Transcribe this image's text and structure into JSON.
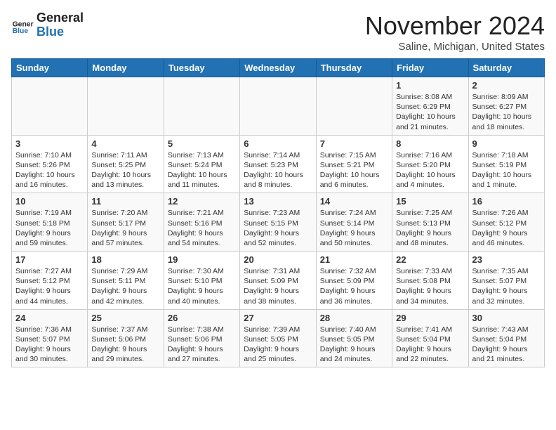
{
  "header": {
    "logo_general": "General",
    "logo_blue": "Blue",
    "month": "November 2024",
    "location": "Saline, Michigan, United States"
  },
  "days_of_week": [
    "Sunday",
    "Monday",
    "Tuesday",
    "Wednesday",
    "Thursday",
    "Friday",
    "Saturday"
  ],
  "weeks": [
    [
      {
        "day": "",
        "info": ""
      },
      {
        "day": "",
        "info": ""
      },
      {
        "day": "",
        "info": ""
      },
      {
        "day": "",
        "info": ""
      },
      {
        "day": "",
        "info": ""
      },
      {
        "day": "1",
        "info": "Sunrise: 8:08 AM\nSunset: 6:29 PM\nDaylight: 10 hours\nand 21 minutes."
      },
      {
        "day": "2",
        "info": "Sunrise: 8:09 AM\nSunset: 6:27 PM\nDaylight: 10 hours\nand 18 minutes."
      }
    ],
    [
      {
        "day": "3",
        "info": "Sunrise: 7:10 AM\nSunset: 5:26 PM\nDaylight: 10 hours\nand 16 minutes."
      },
      {
        "day": "4",
        "info": "Sunrise: 7:11 AM\nSunset: 5:25 PM\nDaylight: 10 hours\nand 13 minutes."
      },
      {
        "day": "5",
        "info": "Sunrise: 7:13 AM\nSunset: 5:24 PM\nDaylight: 10 hours\nand 11 minutes."
      },
      {
        "day": "6",
        "info": "Sunrise: 7:14 AM\nSunset: 5:23 PM\nDaylight: 10 hours\nand 8 minutes."
      },
      {
        "day": "7",
        "info": "Sunrise: 7:15 AM\nSunset: 5:21 PM\nDaylight: 10 hours\nand 6 minutes."
      },
      {
        "day": "8",
        "info": "Sunrise: 7:16 AM\nSunset: 5:20 PM\nDaylight: 10 hours\nand 4 minutes."
      },
      {
        "day": "9",
        "info": "Sunrise: 7:18 AM\nSunset: 5:19 PM\nDaylight: 10 hours\nand 1 minute."
      }
    ],
    [
      {
        "day": "10",
        "info": "Sunrise: 7:19 AM\nSunset: 5:18 PM\nDaylight: 9 hours\nand 59 minutes."
      },
      {
        "day": "11",
        "info": "Sunrise: 7:20 AM\nSunset: 5:17 PM\nDaylight: 9 hours\nand 57 minutes."
      },
      {
        "day": "12",
        "info": "Sunrise: 7:21 AM\nSunset: 5:16 PM\nDaylight: 9 hours\nand 54 minutes."
      },
      {
        "day": "13",
        "info": "Sunrise: 7:23 AM\nSunset: 5:15 PM\nDaylight: 9 hours\nand 52 minutes."
      },
      {
        "day": "14",
        "info": "Sunrise: 7:24 AM\nSunset: 5:14 PM\nDaylight: 9 hours\nand 50 minutes."
      },
      {
        "day": "15",
        "info": "Sunrise: 7:25 AM\nSunset: 5:13 PM\nDaylight: 9 hours\nand 48 minutes."
      },
      {
        "day": "16",
        "info": "Sunrise: 7:26 AM\nSunset: 5:12 PM\nDaylight: 9 hours\nand 46 minutes."
      }
    ],
    [
      {
        "day": "17",
        "info": "Sunrise: 7:27 AM\nSunset: 5:12 PM\nDaylight: 9 hours\nand 44 minutes."
      },
      {
        "day": "18",
        "info": "Sunrise: 7:29 AM\nSunset: 5:11 PM\nDaylight: 9 hours\nand 42 minutes."
      },
      {
        "day": "19",
        "info": "Sunrise: 7:30 AM\nSunset: 5:10 PM\nDaylight: 9 hours\nand 40 minutes."
      },
      {
        "day": "20",
        "info": "Sunrise: 7:31 AM\nSunset: 5:09 PM\nDaylight: 9 hours\nand 38 minutes."
      },
      {
        "day": "21",
        "info": "Sunrise: 7:32 AM\nSunset: 5:09 PM\nDaylight: 9 hours\nand 36 minutes."
      },
      {
        "day": "22",
        "info": "Sunrise: 7:33 AM\nSunset: 5:08 PM\nDaylight: 9 hours\nand 34 minutes."
      },
      {
        "day": "23",
        "info": "Sunrise: 7:35 AM\nSunset: 5:07 PM\nDaylight: 9 hours\nand 32 minutes."
      }
    ],
    [
      {
        "day": "24",
        "info": "Sunrise: 7:36 AM\nSunset: 5:07 PM\nDaylight: 9 hours\nand 30 minutes."
      },
      {
        "day": "25",
        "info": "Sunrise: 7:37 AM\nSunset: 5:06 PM\nDaylight: 9 hours\nand 29 minutes."
      },
      {
        "day": "26",
        "info": "Sunrise: 7:38 AM\nSunset: 5:06 PM\nDaylight: 9 hours\nand 27 minutes."
      },
      {
        "day": "27",
        "info": "Sunrise: 7:39 AM\nSunset: 5:05 PM\nDaylight: 9 hours\nand 25 minutes."
      },
      {
        "day": "28",
        "info": "Sunrise: 7:40 AM\nSunset: 5:05 PM\nDaylight: 9 hours\nand 24 minutes."
      },
      {
        "day": "29",
        "info": "Sunrise: 7:41 AM\nSunset: 5:04 PM\nDaylight: 9 hours\nand 22 minutes."
      },
      {
        "day": "30",
        "info": "Sunrise: 7:43 AM\nSunset: 5:04 PM\nDaylight: 9 hours\nand 21 minutes."
      }
    ]
  ]
}
